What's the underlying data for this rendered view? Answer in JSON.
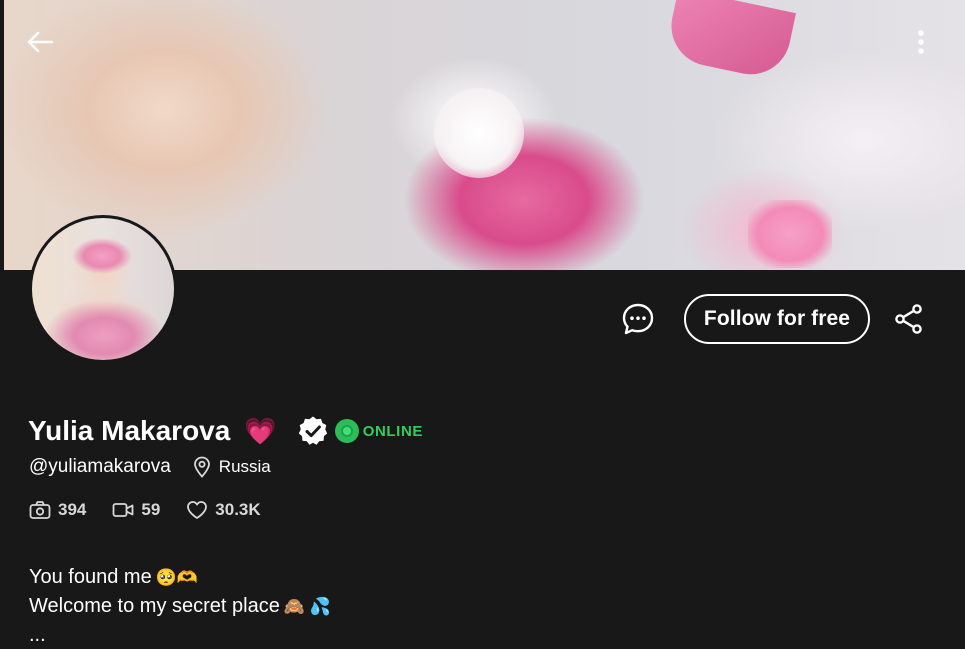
{
  "header": {
    "back_icon": "arrow-left-icon",
    "menu_icon": "more-vertical-icon"
  },
  "actions": {
    "message_icon": "chat-bubble-icon",
    "follow_label": "Follow for free",
    "share_icon": "share-icon"
  },
  "profile": {
    "name": "Yulia Makarova",
    "heart_emoji": "💗",
    "verified_icon": "verified-badge-icon",
    "status": "ONLINE",
    "handle": "@yuliamakarova",
    "location": "Russia"
  },
  "stats": {
    "photos": "394",
    "videos": "59",
    "likes": "30.3K"
  },
  "bio": {
    "line1": "You found me",
    "line1_emoji": "🥺🫶",
    "line2": "Welcome to my secret place",
    "line2_emoji": "🙈 💦",
    "line3": "..."
  },
  "colors": {
    "background": "#181818",
    "online_green": "#2fce5f",
    "text": "#ffffff",
    "stat_text": "#d8d8d8"
  }
}
